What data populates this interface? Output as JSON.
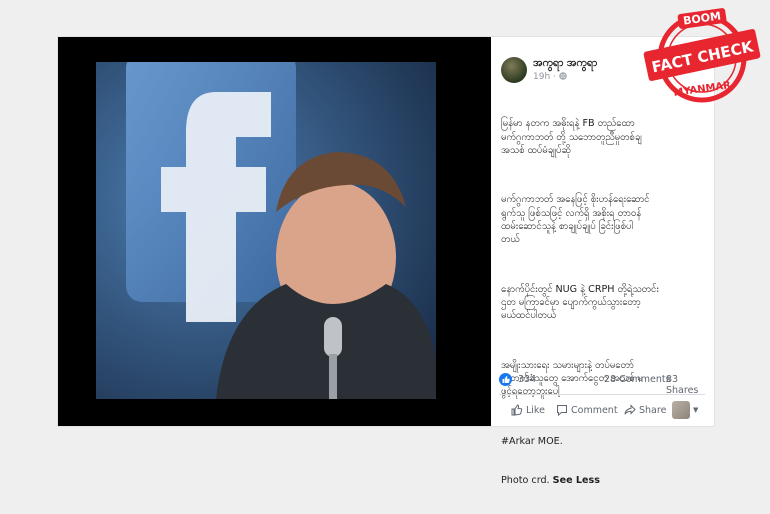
{
  "post": {
    "author": "အကွရာ အကွရာ",
    "time": "19h",
    "body_lines": [
      "မြန်မာ နတက အဓိုးရနဲ့ FB တည်ထော",
      "မက်ဂွကာဘတ် တို့ သဘောတူညီမှုတစ်ချ",
      "အသစ် ထပ်မံချုပ်ဆို",
      "မက်ဂွကာဘတ် အနေဖြင့် စိုးဟန်ရေးဆောင်",
      "ရွက်သူ ဖြစ်သဖြင့် လက်ရှိ အစိုးရ တာဝန်",
      "ထမ်းဆောင်သူနဲ့ စာချုပ်ချုပ် ခြင်းဖြစ်ပါ",
      "တယ်",
      "နောက်ပိုင်းတွင် NUG နဲ့ CRPH တို့ရဲ့သတင်း",
      "ဌတ မကြာခင်မှာ ပျောက်ကွယ်သွားတော့",
      "မယ်ထင်ပါတယ်",
      "အမျိုးသားရေး သမားများနဲ့ တပ်မတော်",
      "ထောက်ခံသူတွေ အောက်ငွေတ အသစ် မ",
      "ဖွင့်ရတော့ဘူးပေါ့"
    ],
    "hashtag": "#Arkar MOE.",
    "photo_credit": "Photo crd.",
    "see_less": "See Less"
  },
  "reactions": {
    "count": "334",
    "comments": "28 Comments",
    "shares": "83 Shares"
  },
  "actions": {
    "like": "Like",
    "comment": "Comment",
    "share": "Share"
  },
  "stamp": {
    "top": "BOOM",
    "main": "FACT CHECK",
    "bottom": "MYANMAR",
    "color": "#e8262f"
  },
  "colors": {
    "facebook_blue": "#1877f2",
    "page_bg": "#efefef"
  }
}
